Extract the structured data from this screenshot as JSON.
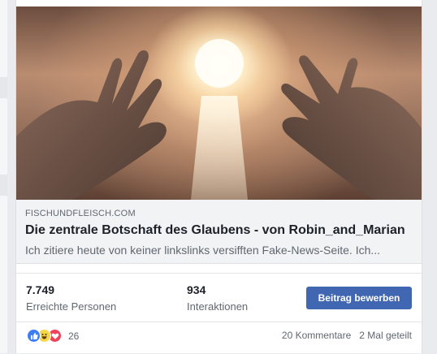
{
  "post": {
    "link_domain": "FISCHUNDFLEISCH.COM",
    "link_title": "Die zentrale Botschaft des Glaubens - von Robin_and_Marian",
    "link_description": "Ich zitiere heute von keiner linkslinks versifften Fake-News-Seite. Ich..."
  },
  "insights": {
    "reach_value": "7.749",
    "reach_label": "Erreichte Personen",
    "interactions_value": "934",
    "interactions_label": "Interaktionen",
    "boost_label": "Beitrag bewerben"
  },
  "footer": {
    "reaction_icons": [
      "like-icon",
      "haha-icon",
      "love-icon"
    ],
    "reaction_count": "26",
    "comments_label": "20 Kommentare",
    "shares_label": "2 Mal geteilt"
  },
  "colors": {
    "boost_button": "#4267b2",
    "like": "#3d7ef2",
    "haha": "#f7d64a",
    "love": "#f0405a"
  }
}
